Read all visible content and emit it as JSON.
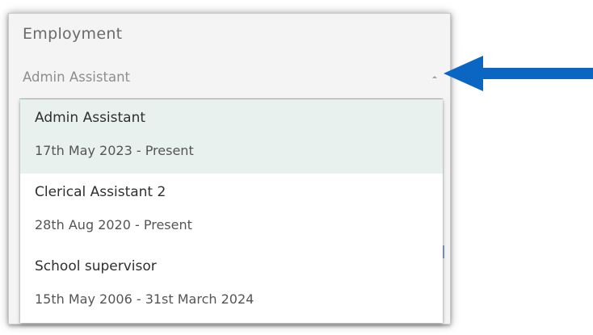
{
  "field": {
    "label": "Employment",
    "selected_value": "Admin Assistant",
    "caret_icon": "caret-up-icon"
  },
  "options": [
    {
      "title": "Admin Assistant",
      "dates": "17th May 2023 - Present",
      "selected": true
    },
    {
      "title": "Clerical Assistant 2",
      "dates": "28th Aug 2020 - Present",
      "selected": false
    },
    {
      "title": "School supervisor",
      "dates": "15th May 2006 - 31st March 2024",
      "selected": false
    }
  ],
  "annotation": {
    "arrow_icon": "arrow-left-icon",
    "arrow_color": "#0b66c3"
  },
  "colors": {
    "selected_option_bg": "#e8f1ee",
    "card_bg": "#f4f4f4"
  }
}
